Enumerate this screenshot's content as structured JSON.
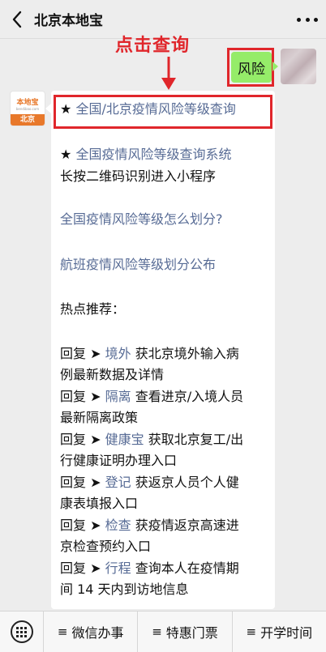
{
  "header": {
    "title": "北京本地宝",
    "back_icon": "chevron-left-icon",
    "more_icon": "more-dots-icon"
  },
  "annotation": {
    "text": "点击查询",
    "color": "#e0262b"
  },
  "outgoing_message": {
    "text": "风险",
    "bubble_color": "#95ec69"
  },
  "incoming_avatar": {
    "logo_text": "本地宝",
    "logo_sub": "bendibao.com",
    "city": "北京",
    "brand_color": "#e8782a"
  },
  "reply": {
    "line1_star": "★ ",
    "line1_link": "全国/北京疫情风险等级查询",
    "line2_star": "★ ",
    "line2_link": "全国疫情风险等级查询系统",
    "line3": "长按二维码识别进入小程序",
    "line4_link": "全国疫情风险等级怎么划分?",
    "line5_link": "航班疫情风险等级划分公布",
    "hot_title": "热点推荐：",
    "items": [
      {
        "prefix": "回复 ➤ ",
        "keyword": "境外",
        "desc1": " 获北京境外输入病",
        "desc2": "例最新数据及详情"
      },
      {
        "prefix": "回复 ➤ ",
        "keyword": "隔离",
        "desc1": " 查看进京/入境人员",
        "desc2": "最新隔离政策"
      },
      {
        "prefix": "回复 ➤ ",
        "keyword": "健康宝",
        "desc1": " 获取北京复工/出",
        "desc2": "行健康证明办理入口"
      },
      {
        "prefix": "回复 ➤ ",
        "keyword": "登记",
        "desc1": " 获返京人员个人健",
        "desc2": "康表填报入口"
      },
      {
        "prefix": "回复 ➤ ",
        "keyword": "检查",
        "desc1": " 获疫情返京高速进",
        "desc2": "京检查预约入口"
      },
      {
        "prefix": "回复 ➤ ",
        "keyword": "行程",
        "desc1": " 查询本人在疫情期",
        "desc2": "间 14 天内到访地信息"
      }
    ],
    "link_color": "#576b95"
  },
  "bottom_bar": {
    "keyboard_icon": "keyboard-icon",
    "menu_icon_glyph": "≡",
    "menus": [
      "微信办事",
      "特惠门票",
      "开学时间"
    ]
  }
}
